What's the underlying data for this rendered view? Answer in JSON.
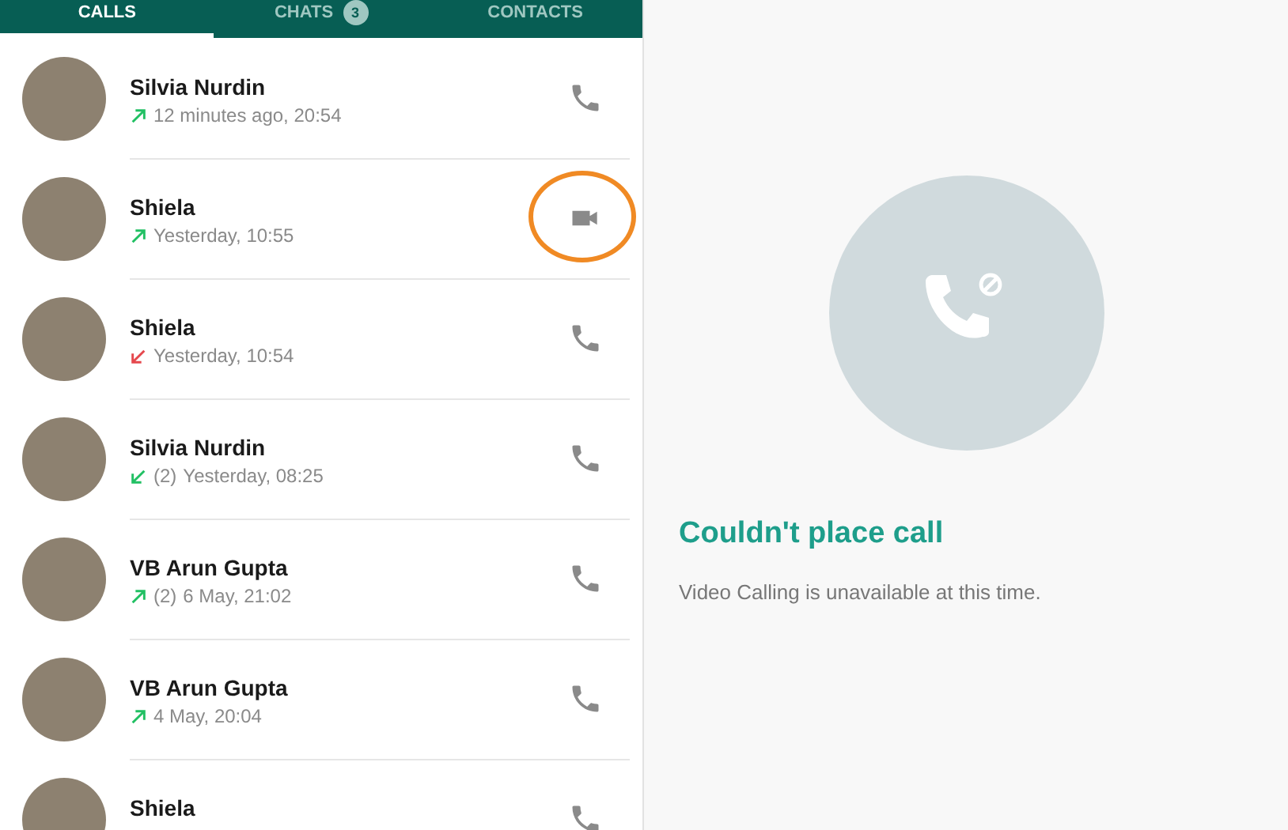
{
  "tabs": [
    {
      "label": "CALLS",
      "selected": true
    },
    {
      "label": "CHATS",
      "selected": false,
      "badge": "3"
    },
    {
      "label": "CONTACTS",
      "selected": false
    }
  ],
  "calls": [
    {
      "name": "Silvia Nurdin",
      "kind": "outgoing",
      "time": "12 minutes ago, 20:54",
      "video": false,
      "highlighted": false
    },
    {
      "name": "Shiela",
      "kind": "outgoing",
      "time": "Yesterday, 10:55",
      "video": true,
      "highlighted": true
    },
    {
      "name": "Shiela",
      "kind": "missed",
      "time": "Yesterday, 10:54",
      "video": false,
      "highlighted": false
    },
    {
      "name": "Silvia Nurdin",
      "kind": "incoming",
      "count": "(2)",
      "time": "Yesterday, 08:25",
      "video": false,
      "highlighted": false
    },
    {
      "name": "VB Arun Gupta",
      "kind": "outgoing",
      "count": "(2)",
      "time": "6 May, 21:02",
      "video": false,
      "highlighted": false
    },
    {
      "name": "VB Arun Gupta",
      "kind": "outgoing",
      "time": "4 May, 20:04",
      "video": false,
      "highlighted": false
    },
    {
      "name": "Shiela",
      "video": false,
      "highlighted": false
    }
  ],
  "error": {
    "title": "Couldn't place call",
    "message": "Video Calling is unavailable at this time."
  }
}
